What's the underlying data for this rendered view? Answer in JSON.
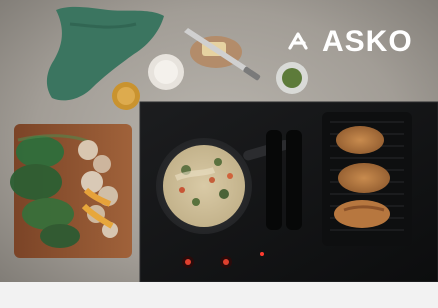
{
  "brand": {
    "name": "ASKO",
    "text_color": "#ffffff"
  },
  "palette": {
    "countertop": "#a7a29b",
    "cooktop": "#151617",
    "grill": "#0e0f10",
    "cutting_board": "#9b5a33",
    "pan": "#2a2b2d",
    "towel": "#3b7560"
  }
}
